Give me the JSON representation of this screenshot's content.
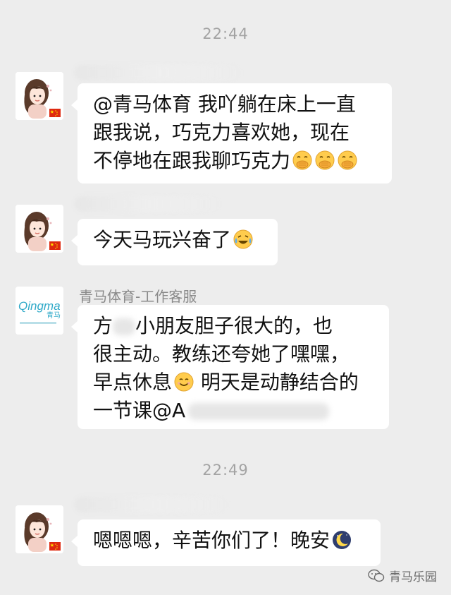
{
  "chat": {
    "time1": "22:44",
    "time2": "22:49",
    "msg1": {
      "line1": "@青马体育 我吖躺在床上一直",
      "line2": "跟我说，巧克力喜欢她，现在",
      "line3": "不停地在跟我聊巧克力"
    },
    "msg2": {
      "text": "今天马玩兴奋了"
    },
    "msg3": {
      "sender": "青马体育-工作客服",
      "line1_prefix": "方",
      "line1_suffix": "小朋友胆子很大的，也",
      "line2": "很主动。教练还夸她了嘿嘿，",
      "line3_a": "早点休息",
      "line3_b": " 明天是动静结合的",
      "line4": "一节课@A"
    },
    "msg4": {
      "text": "嗯嗯嗯，辛苦你们了！晚安"
    }
  },
  "agent_avatar": {
    "logo_text": "Qingma",
    "logo_sub": "青马"
  },
  "icons": {
    "emoji_hand_over_mouth": "hand-over-mouth-emoji",
    "emoji_crying_laughing": "crying-laughing-emoji",
    "emoji_smile": "smiling-emoji",
    "emoji_moon": "crescent-moon-emoji",
    "flag": "china-flag-icon"
  },
  "watermark": {
    "text": "青马乐园"
  },
  "colors": {
    "background": "#ededed",
    "bubble": "#ffffff",
    "timestamp": "#a3a3a3",
    "logo_blue": "#2ea9c8"
  }
}
